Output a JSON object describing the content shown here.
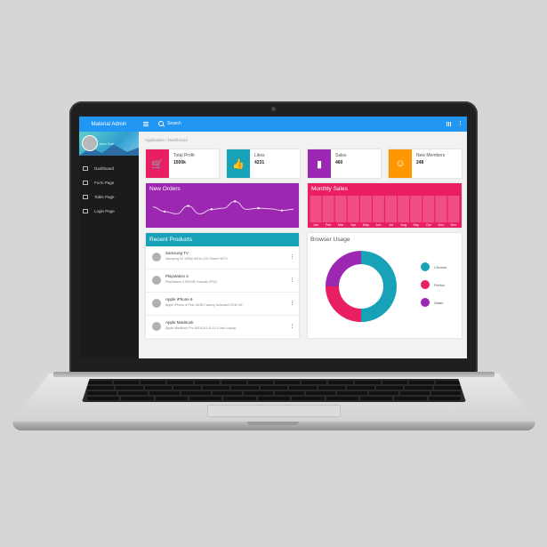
{
  "app": {
    "title": "Material Admin"
  },
  "sidebar": {
    "profile_name": "Jane Doe",
    "items": [
      {
        "label": "Dashboard",
        "icon": "dashboard-icon"
      },
      {
        "label": "Form Page",
        "icon": "form-icon"
      },
      {
        "label": "Table Page",
        "icon": "table-icon"
      },
      {
        "label": "Login Page",
        "icon": "login-icon"
      }
    ]
  },
  "topbar": {
    "search_text": "Search"
  },
  "breadcrumb": "Application / Dashboard",
  "stats": [
    {
      "label": "Total Profit",
      "value": "1500k",
      "color": "#e91e63",
      "icon": "cart-icon",
      "glyph": "🛒"
    },
    {
      "label": "Likes",
      "value": "4231",
      "color": "#17a2b8",
      "icon": "thumb-up-icon",
      "glyph": "👍"
    },
    {
      "label": "Sales",
      "value": "460",
      "color": "#9c27b0",
      "icon": "bar-chart-icon",
      "glyph": "▮"
    },
    {
      "label": "New Members",
      "value": "248",
      "color": "#ff9800",
      "icon": "face-icon",
      "glyph": "☺"
    }
  ],
  "new_orders": {
    "title": "New Orders",
    "values": [
      30,
      22,
      18,
      32,
      18,
      26,
      28,
      40,
      26,
      28,
      27,
      24,
      26
    ]
  },
  "monthly_sales": {
    "title": "Monthly Sales",
    "months": [
      "Jan",
      "Feb",
      "Mar",
      "Apr",
      "May",
      "Jun",
      "Jul",
      "Aug",
      "Sep",
      "Oct",
      "Nov",
      "Dec"
    ]
  },
  "recent_products": {
    "title": "Recent Products",
    "items": [
      {
        "name": "Samsung TV",
        "desc": "Samsung 32 1080p 60Hz LED Smart HDTV."
      },
      {
        "name": "Playstation 4",
        "desc": "PlayStation 4 500GB Console (PS4)"
      },
      {
        "name": "Apple iPhone 6",
        "desc": "Apple iPhone 6 Plus 16GB Factory Unlocked GSM 4G"
      },
      {
        "name": "Apple MacBook",
        "desc": "Apple MacBook Pro MD101LL/A 13.3-Inch Laptop"
      }
    ]
  },
  "browser_usage": {
    "title": "Browser Usage",
    "segments": [
      {
        "label": "Chrome",
        "value": 50,
        "color": "#17a2b8"
      },
      {
        "label": "Firefox",
        "value": 25,
        "color": "#e91e63"
      },
      {
        "label": "Safari",
        "value": 25,
        "color": "#9c27b0"
      }
    ]
  }
}
